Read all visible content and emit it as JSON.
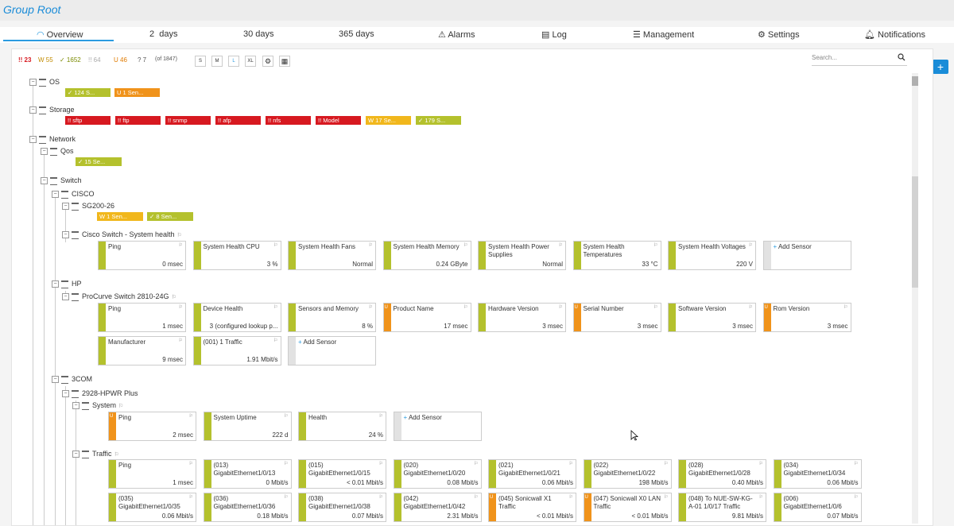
{
  "title": "Group Root",
  "tabs": [
    {
      "label": "Overview",
      "icon": "overview-icon"
    },
    {
      "label": "2  days"
    },
    {
      "label": "30 days"
    },
    {
      "label": "365 days"
    },
    {
      "label": "Alarms",
      "icon": "warning-icon"
    },
    {
      "label": "Log",
      "icon": "log-icon"
    },
    {
      "label": "Management",
      "icon": "sliders-icon"
    },
    {
      "label": "Settings",
      "icon": "gear-icon"
    },
    {
      "label": "Notifications",
      "icon": "bell-icon"
    }
  ],
  "toolbar": {
    "down": "!! 23",
    "warning": "W 55",
    "up": "✓ 1652",
    "paused": "!! 64",
    "unusual": "U 46",
    "unknown": "? 7",
    "total": "(of 1847)",
    "sizes": [
      "S",
      "M",
      "L",
      "XL"
    ]
  },
  "search_placeholder": "Search...",
  "colors": {
    "up": "#b4c12d",
    "warn": "#f1b71c",
    "down": "#d71920",
    "unusual": "#f0931b",
    "accent": "#1a8cd8"
  },
  "tree": {
    "os": "OS",
    "os_pills": [
      "✓ 124 S...",
      "U 1 Sen..."
    ],
    "storage": "Storage",
    "storage_pills": [
      "!! sftp",
      "!! ftp",
      "!! snmp",
      "!! afp",
      "!! nfs",
      "!! Model",
      "W 17 Se...",
      "✓ 179 S..."
    ],
    "network": "Network",
    "qos": "Qos",
    "qos_pills": [
      "✓ 15 Se..."
    ],
    "switch": "Switch",
    "cisco": "CISCO",
    "sg200": "SG200-26",
    "sg200_pills": [
      "W 1 Sen...",
      "✓ 8 Sen..."
    ],
    "cisco_health": "Cisco Switch - System health",
    "hp": "HP",
    "procurve": "ProCurve Switch 2810-24G",
    "3com": "3COM",
    "hpwr": "2928-HPWR Plus",
    "system": "System",
    "traffic": "Traffic"
  },
  "cisco_sensors": [
    {
      "name": "Ping",
      "value": "0 msec",
      "status": "up"
    },
    {
      "name": "System Health CPU",
      "value": "3 %",
      "status": "up"
    },
    {
      "name": "System Health Fans",
      "value": "Normal",
      "status": "up"
    },
    {
      "name": "System Health Memory",
      "value": "0.24 GByte",
      "status": "up"
    },
    {
      "name": "System Health Power Supplies",
      "value": "Normal",
      "status": "up"
    },
    {
      "name": "System Health Temperatures",
      "value": "33 °C",
      "status": "up"
    },
    {
      "name": "System Health Voltages",
      "value": "220 V",
      "status": "up"
    },
    {
      "name": "Add Sensor",
      "value": "",
      "status": "add"
    }
  ],
  "hp_sensors": [
    {
      "name": "Ping",
      "value": "1 msec",
      "status": "up"
    },
    {
      "name": "Device Health",
      "value": "3 (configured lookup p...",
      "status": "up"
    },
    {
      "name": "Sensors and Memory",
      "value": "8 %",
      "status": "up"
    },
    {
      "name": "Product Name",
      "value": "17 msec",
      "status": "unusual"
    },
    {
      "name": "Hardware Version",
      "value": "3 msec",
      "status": "up"
    },
    {
      "name": "Serial Number",
      "value": "3 msec",
      "status": "unusual"
    },
    {
      "name": "Software Version",
      "value": "3 msec",
      "status": "up"
    },
    {
      "name": "Rom Version",
      "value": "3 msec",
      "status": "unusual"
    },
    {
      "name": "Manufacturer",
      "value": "9 msec",
      "status": "up"
    },
    {
      "name": "(001) 1 Traffic",
      "value": "1.91 Mbit/s",
      "status": "up"
    },
    {
      "name": "Add Sensor",
      "value": "",
      "status": "add"
    }
  ],
  "system_sensors": [
    {
      "name": "Ping",
      "value": "2 msec",
      "status": "unusual"
    },
    {
      "name": "System Uptime",
      "value": "222 d",
      "status": "up"
    },
    {
      "name": "Health",
      "value": "24 %",
      "status": "up"
    },
    {
      "name": "Add Sensor",
      "value": "",
      "status": "add"
    }
  ],
  "traffic_sensors": [
    {
      "name": "Ping",
      "value": "1 msec",
      "status": "up"
    },
    {
      "name": "(013) GigabitEthernet1/0/13",
      "value": "0 Mbit/s",
      "status": "up"
    },
    {
      "name": "(015) GigabitEthernet1/0/15",
      "value": "< 0.01 Mbit/s",
      "status": "up"
    },
    {
      "name": "(020) GigabitEthernet1/0/20",
      "value": "0.08 Mbit/s",
      "status": "up"
    },
    {
      "name": "(021) GigabitEthernet1/0/21",
      "value": "0.06 Mbit/s",
      "status": "up"
    },
    {
      "name": "(022) GigabitEthernet1/0/22",
      "value": "198 Mbit/s",
      "status": "up"
    },
    {
      "name": "(028) GigabitEthernet1/0/28",
      "value": "0.40 Mbit/s",
      "status": "up"
    },
    {
      "name": "(034) GigabitEthernet1/0/34",
      "value": "0.06 Mbit/s",
      "status": "up"
    },
    {
      "name": "(035) GigabitEthernet1/0/35",
      "value": "0.06 Mbit/s",
      "status": "up"
    },
    {
      "name": "(036) GigabitEthernet1/0/36",
      "value": "0.18 Mbit/s",
      "status": "up"
    },
    {
      "name": "(038) GigabitEthernet1/0/38",
      "value": "0.07 Mbit/s",
      "status": "up"
    },
    {
      "name": "(042) GigabitEthernet1/0/42",
      "value": "2.31 Mbit/s",
      "status": "up"
    },
    {
      "name": "(045) Sonicwall X1 Traffic",
      "value": "< 0.01 Mbit/s",
      "status": "unusual"
    },
    {
      "name": "(047) Sonicwall X0 LAN Traffic",
      "value": "< 0.01 Mbit/s",
      "status": "unusual"
    },
    {
      "name": "(048) To NUE-SW-KG-A-01 1/0/17 Traffic",
      "value": "9.81 Mbit/s",
      "status": "up"
    },
    {
      "name": "(006) GigabitEthernet1/0/6",
      "value": "0.07 Mbit/s",
      "status": "up"
    }
  ]
}
